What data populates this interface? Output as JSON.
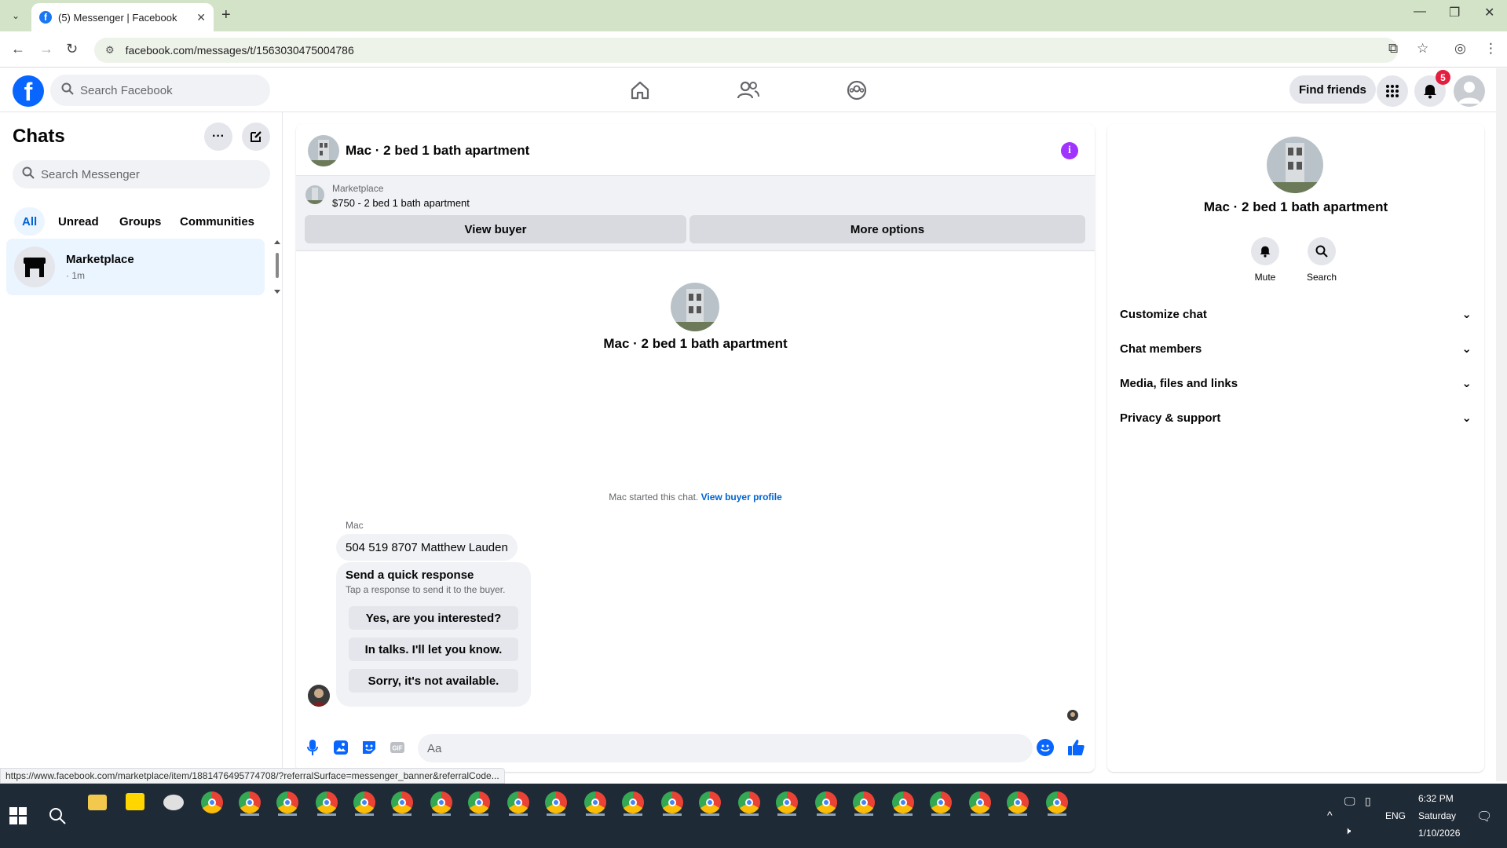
{
  "browser": {
    "tab_title": "(5) Messenger | Facebook",
    "url": "facebook.com/messages/t/1563030475004786",
    "status_url": "https://www.facebook.com/marketplace/item/1881476495774708/?referralSurface=messenger_banner&referralCode..."
  },
  "header": {
    "search_placeholder": "Search Facebook",
    "find_friends_label": "Find friends",
    "notification_count": "5"
  },
  "chats": {
    "title": "Chats",
    "search_placeholder": "Search Messenger",
    "filters": [
      "All",
      "Unread",
      "Groups",
      "Communities"
    ],
    "items": [
      {
        "name": "Marketplace",
        "time": "· 1m"
      }
    ]
  },
  "conversation": {
    "title": "Mac · 2 bed 1 bath apartment",
    "banner": {
      "label": "Marketplace",
      "listing": "$750 - 2 bed 1 bath apartment",
      "view_buyer": "View buyer",
      "more_options": "More options"
    },
    "center_name": "Mac · 2 bed 1 bath apartment",
    "started_text": "Mac started this chat.",
    "started_link": "View buyer profile",
    "sender": "Mac",
    "message": "504 519 8707 Matthew Lauden",
    "quick_response": {
      "heading": "Send a quick response",
      "subtext": "Tap a response to send it to the buyer.",
      "options": [
        "Yes, are you interested?",
        "In talks. I'll let you know.",
        "Sorry, it's not available."
      ]
    },
    "composer_placeholder": "Aa"
  },
  "info_panel": {
    "name": "Mac · 2 bed 1 bath apartment",
    "actions": [
      "Mute",
      "Search"
    ],
    "sections": [
      "Customize chat",
      "Chat members",
      "Media, files and links",
      "Privacy & support"
    ]
  },
  "taskbar": {
    "time": "6:32 PM",
    "day": "Saturday",
    "date": "1/10/2026",
    "lang": "ENG"
  },
  "colors": {
    "accent": "#0866ff",
    "active_bg": "#ebf5ff",
    "badge": "#e41e3f",
    "info_icon": "#a033ff"
  }
}
